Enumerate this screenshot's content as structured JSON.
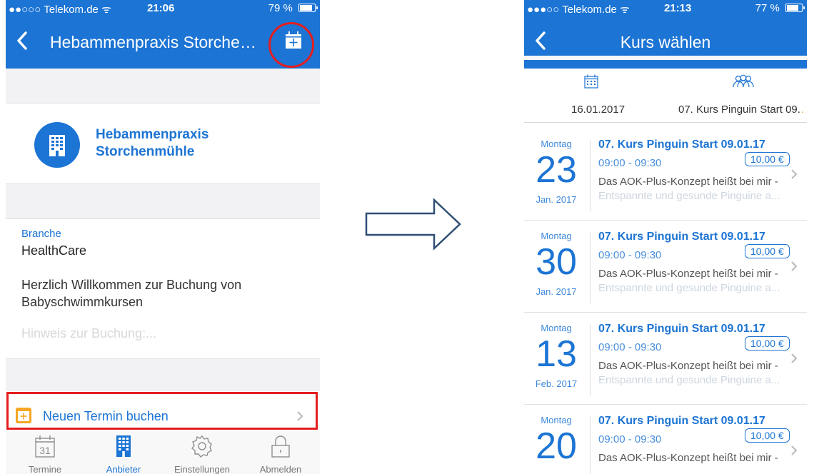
{
  "left": {
    "status": {
      "carrier": "●●○○○ Telekom.de ᯤ",
      "time": "21:06",
      "battery": "79 %",
      "battery_level": 0.79
    },
    "nav": {
      "title": "Hebammenpraxis Storche…"
    },
    "provider": {
      "name_line1": "Hebammenpraxis",
      "name_line2": "Storchenmühle"
    },
    "info": {
      "industry_label": "Branche",
      "industry_value": "HealthCare",
      "welcome_line1": "Herzlich Willkommen zur Buchung von",
      "welcome_line2": "Babyschwimmkursen",
      "hint": "Hinweis zur Buchung:..."
    },
    "book_label": "Neuen Termin buchen",
    "tabbar": {
      "calendar_day": "31",
      "tabs": [
        "Termine",
        "Anbieter",
        "Einstellungen",
        "Abmelden"
      ]
    }
  },
  "right": {
    "status": {
      "carrier": "●●●○○ Telekom.de ᯤ",
      "time": "21:13",
      "battery": "77 %",
      "battery_level": 0.77
    },
    "nav": {
      "title": "Kurs wählen"
    },
    "filter": {
      "date": "16.01.2017",
      "course": "07. Kurs Pinguin Start 09.",
      "ellipsis": "…"
    },
    "courses": [
      {
        "weekday": "Montag",
        "day": "23",
        "month": "Jan. 2017",
        "title": "07. Kurs Pinguin Start 09.01.17",
        "time": "09:00 - 09:30",
        "price": "10,00 €",
        "desc1": "Das AOK-Plus-Konzept heißt bei mir -",
        "desc2": "Entspannte und gesunde Pinguine a..."
      },
      {
        "weekday": "Montag",
        "day": "30",
        "month": "Jan. 2017",
        "title": "07. Kurs Pinguin Start 09.01.17",
        "time": "09:00 - 09:30",
        "price": "10,00 €",
        "desc1": "Das AOK-Plus-Konzept heißt bei mir -",
        "desc2": "Entspannte und gesunde Pinguine a..."
      },
      {
        "weekday": "Montag",
        "day": "13",
        "month": "Feb. 2017",
        "title": "07. Kurs Pinguin Start 09.01.17",
        "time": "09:00 - 09:30",
        "price": "10,00 €",
        "desc1": "Das AOK-Plus-Konzept heißt bei mir -",
        "desc2": "Entspannte und gesunde Pinguine a..."
      },
      {
        "weekday": "Montag",
        "day": "20",
        "month": "",
        "title": "07. Kurs Pinguin Start 09.01.17",
        "time": "09:00 - 09:30",
        "price": "10,00 €",
        "desc1": "Das AOK-Plus-Konzept heißt bei mir -",
        "desc2": ""
      }
    ]
  },
  "colors": {
    "primary": "#1c74d4",
    "highlight": "#e41e1e",
    "accent": "#f5a623"
  }
}
